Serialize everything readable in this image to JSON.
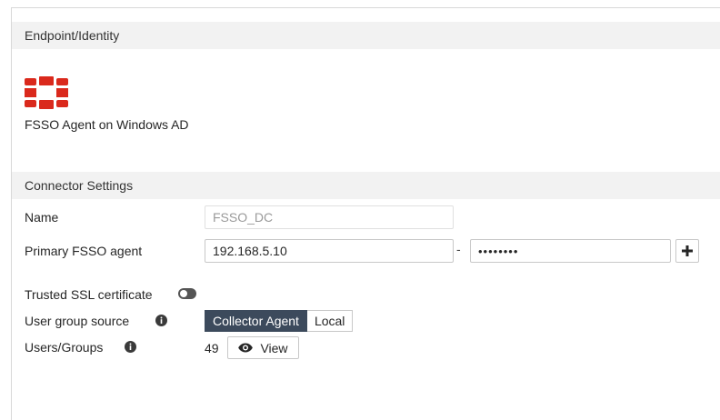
{
  "sections": {
    "endpoint_identity": "Endpoint/Identity",
    "connector_settings": "Connector Settings"
  },
  "connector": {
    "type_label": "FSSO Agent on Windows AD",
    "logo_icon": "fortinet-logo",
    "brand_color": "#da291c"
  },
  "form": {
    "name_label": "Name",
    "name_value": "FSSO_DC",
    "primary_agent_label": "Primary FSSO agent",
    "primary_agent_ip": "192.168.5.10",
    "separator": "-",
    "primary_agent_password": "••••••••",
    "add_icon": "plus-icon",
    "trusted_ssl_label": "Trusted SSL certificate",
    "trusted_ssl_enabled": false,
    "user_group_source_label": "User group source",
    "user_group_source_options": [
      "Collector Agent",
      "Local"
    ],
    "user_group_source_selected": "Collector Agent",
    "users_groups_label": "Users/Groups",
    "users_groups_count": "49",
    "view_label": "View",
    "view_icon": "eye-icon",
    "info_icon": "info-icon"
  },
  "colors": {
    "active_segment": "#3c4a5c",
    "section_header_bg": "#f2f2f2"
  }
}
